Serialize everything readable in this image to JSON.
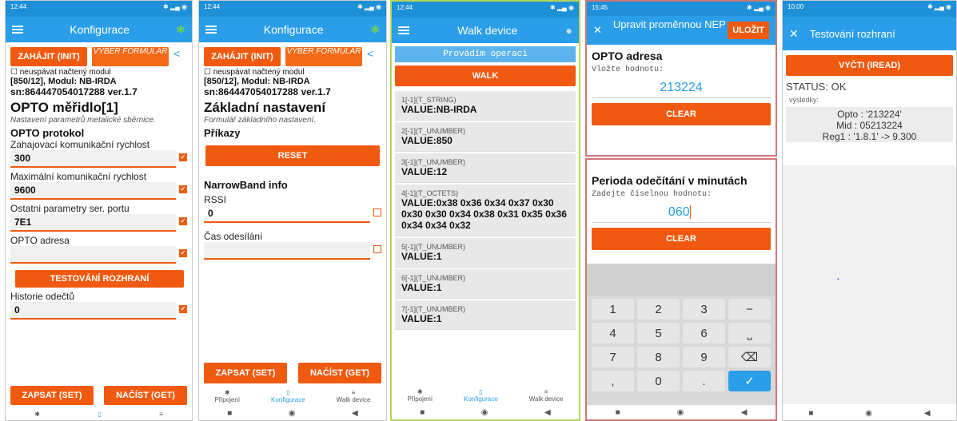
{
  "p1": {
    "time": "12:44",
    "title": "Konfigurace",
    "init": "ZAHÁJIT (INIT)",
    "form": "VYBER FORMULÁŘ",
    "check_label": "neuspávat načtený modul",
    "model": "[850/12], Modul: NB-IRDA",
    "sn": "sn:864447054017288 ver.1.7",
    "section": "OPTO měřidlo[1]",
    "section_sub": "Nastavení parametrů metalické sběrnice.",
    "proto": "OPTO protokol",
    "f1_label": "Zahajovací komunikační rychlost",
    "f1_value": "300",
    "f2_label": "Maximální komunikační rychlost",
    "f2_value": "9600",
    "f3_label": "Ostatni parametry ser. portu",
    "f3_value": "7E1",
    "f4_label": "OPTO adresa",
    "f4_value": "",
    "test_btn": "TESTOVÁNÍ ROZHRANÍ",
    "f5_label": "Historie odečtů",
    "f5_value": "0",
    "set": "ZAPSAT (SET)",
    "get": "NAČÍST (GET)"
  },
  "p2": {
    "time": "12:44",
    "title": "Konfigurace",
    "init": "ZAHÁJIT (INIT)",
    "form": "VYBER FORMULÁŘ",
    "check_label": "neuspávat načtený modul",
    "model": "[850/12], Modul: NB-IRDA",
    "sn": "sn:864447054017288 ver.1.7",
    "section": "Základní nastavení",
    "section_sub": "Formulář základního nastavení.",
    "cmds": "Příkazy",
    "reset": "RESET",
    "nb": "NarrowBand info",
    "rssi": "RSSI",
    "rssi_value": "0",
    "cas": "Čas odesílání",
    "set": "ZAPSAT (SET)",
    "get": "NAČÍST (GET)",
    "nav": [
      "Připojení",
      "Konfigurace",
      "Walk device"
    ]
  },
  "p3": {
    "time": "12:44",
    "title": "Walk device",
    "status": "Provádím operaci",
    "walk": "WALK",
    "items": [
      {
        "k": "1[-1](T_STRING)",
        "v": "VALUE:NB-IRDA"
      },
      {
        "k": "2[-1](T_UNUMBER)",
        "v": "VALUE:850"
      },
      {
        "k": "3[-1](T_UNUMBER)",
        "v": "VALUE:12"
      },
      {
        "k": "4[-1](T_OCTETS)",
        "v": "VALUE:0x38 0x36 0x34 0x37 0x30 0x30 0x30 0x34 0x38 0x31 0x35 0x36 0x34 0x34 0x32"
      },
      {
        "k": "5[-1](T_UNUMBER)",
        "v": "VALUE:1"
      },
      {
        "k": "6[-1](T_UNUMBER)",
        "v": "VALUE:1"
      },
      {
        "k": "7[-1](T_UNUMBER)",
        "v": "VALUE:1"
      }
    ],
    "nav": [
      "Připojení",
      "Konfigurace",
      "Walk device"
    ]
  },
  "p4": {
    "time": "15:45",
    "title": "Upravit proměnnou NEP",
    "save": "ULOŽIT",
    "s1_title": "OPTO adresa",
    "s1_hint": "Vložte hodnotu:",
    "s1_value": "213224",
    "clear": "CLEAR",
    "s2_title": "Perioda odečítání v minutách",
    "s2_hint": "Zadejte číselnou hodnotu:",
    "s2_value": "060",
    "keys": [
      "1",
      "2",
      "3",
      "−",
      "4",
      "5",
      "6",
      "⎵",
      "7",
      "8",
      "9",
      "⌫",
      ",",
      "0",
      ".",
      "✓"
    ]
  },
  "p5": {
    "time": "10:00",
    "title": "Testování rozhraní",
    "read": "VYČTI (IREAD)",
    "status": "STATUS: OK",
    "results": "výsledky:",
    "r1": "Opto : '213224'",
    "r2": "Mid : 05213224",
    "r3": "Reg1 : '1.8.1' -> 9.300"
  }
}
